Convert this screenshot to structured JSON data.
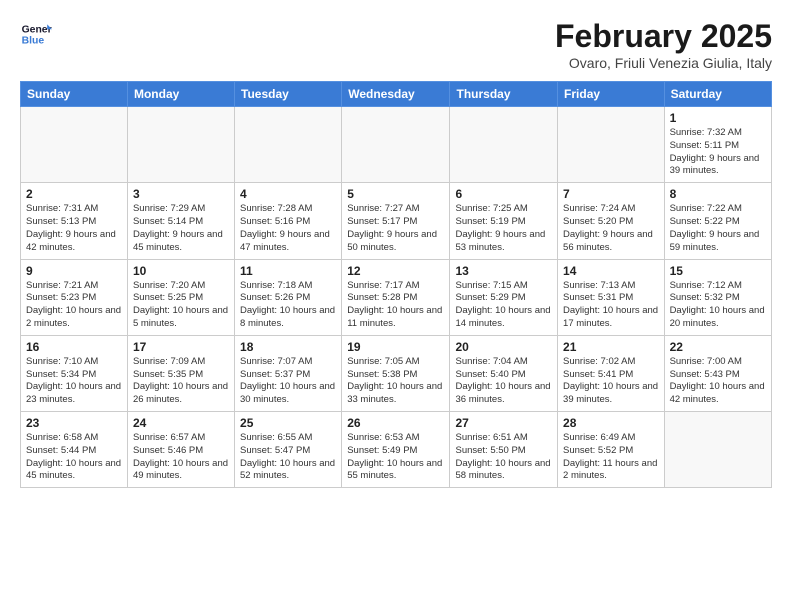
{
  "header": {
    "logo_line1": "General",
    "logo_line2": "Blue",
    "month": "February 2025",
    "location": "Ovaro, Friuli Venezia Giulia, Italy"
  },
  "days_of_week": [
    "Sunday",
    "Monday",
    "Tuesday",
    "Wednesday",
    "Thursday",
    "Friday",
    "Saturday"
  ],
  "weeks": [
    [
      {
        "num": "",
        "info": ""
      },
      {
        "num": "",
        "info": ""
      },
      {
        "num": "",
        "info": ""
      },
      {
        "num": "",
        "info": ""
      },
      {
        "num": "",
        "info": ""
      },
      {
        "num": "",
        "info": ""
      },
      {
        "num": "1",
        "info": "Sunrise: 7:32 AM\nSunset: 5:11 PM\nDaylight: 9 hours and 39 minutes."
      }
    ],
    [
      {
        "num": "2",
        "info": "Sunrise: 7:31 AM\nSunset: 5:13 PM\nDaylight: 9 hours and 42 minutes."
      },
      {
        "num": "3",
        "info": "Sunrise: 7:29 AM\nSunset: 5:14 PM\nDaylight: 9 hours and 45 minutes."
      },
      {
        "num": "4",
        "info": "Sunrise: 7:28 AM\nSunset: 5:16 PM\nDaylight: 9 hours and 47 minutes."
      },
      {
        "num": "5",
        "info": "Sunrise: 7:27 AM\nSunset: 5:17 PM\nDaylight: 9 hours and 50 minutes."
      },
      {
        "num": "6",
        "info": "Sunrise: 7:25 AM\nSunset: 5:19 PM\nDaylight: 9 hours and 53 minutes."
      },
      {
        "num": "7",
        "info": "Sunrise: 7:24 AM\nSunset: 5:20 PM\nDaylight: 9 hours and 56 minutes."
      },
      {
        "num": "8",
        "info": "Sunrise: 7:22 AM\nSunset: 5:22 PM\nDaylight: 9 hours and 59 minutes."
      }
    ],
    [
      {
        "num": "9",
        "info": "Sunrise: 7:21 AM\nSunset: 5:23 PM\nDaylight: 10 hours and 2 minutes."
      },
      {
        "num": "10",
        "info": "Sunrise: 7:20 AM\nSunset: 5:25 PM\nDaylight: 10 hours and 5 minutes."
      },
      {
        "num": "11",
        "info": "Sunrise: 7:18 AM\nSunset: 5:26 PM\nDaylight: 10 hours and 8 minutes."
      },
      {
        "num": "12",
        "info": "Sunrise: 7:17 AM\nSunset: 5:28 PM\nDaylight: 10 hours and 11 minutes."
      },
      {
        "num": "13",
        "info": "Sunrise: 7:15 AM\nSunset: 5:29 PM\nDaylight: 10 hours and 14 minutes."
      },
      {
        "num": "14",
        "info": "Sunrise: 7:13 AM\nSunset: 5:31 PM\nDaylight: 10 hours and 17 minutes."
      },
      {
        "num": "15",
        "info": "Sunrise: 7:12 AM\nSunset: 5:32 PM\nDaylight: 10 hours and 20 minutes."
      }
    ],
    [
      {
        "num": "16",
        "info": "Sunrise: 7:10 AM\nSunset: 5:34 PM\nDaylight: 10 hours and 23 minutes."
      },
      {
        "num": "17",
        "info": "Sunrise: 7:09 AM\nSunset: 5:35 PM\nDaylight: 10 hours and 26 minutes."
      },
      {
        "num": "18",
        "info": "Sunrise: 7:07 AM\nSunset: 5:37 PM\nDaylight: 10 hours and 30 minutes."
      },
      {
        "num": "19",
        "info": "Sunrise: 7:05 AM\nSunset: 5:38 PM\nDaylight: 10 hours and 33 minutes."
      },
      {
        "num": "20",
        "info": "Sunrise: 7:04 AM\nSunset: 5:40 PM\nDaylight: 10 hours and 36 minutes."
      },
      {
        "num": "21",
        "info": "Sunrise: 7:02 AM\nSunset: 5:41 PM\nDaylight: 10 hours and 39 minutes."
      },
      {
        "num": "22",
        "info": "Sunrise: 7:00 AM\nSunset: 5:43 PM\nDaylight: 10 hours and 42 minutes."
      }
    ],
    [
      {
        "num": "23",
        "info": "Sunrise: 6:58 AM\nSunset: 5:44 PM\nDaylight: 10 hours and 45 minutes."
      },
      {
        "num": "24",
        "info": "Sunrise: 6:57 AM\nSunset: 5:46 PM\nDaylight: 10 hours and 49 minutes."
      },
      {
        "num": "25",
        "info": "Sunrise: 6:55 AM\nSunset: 5:47 PM\nDaylight: 10 hours and 52 minutes."
      },
      {
        "num": "26",
        "info": "Sunrise: 6:53 AM\nSunset: 5:49 PM\nDaylight: 10 hours and 55 minutes."
      },
      {
        "num": "27",
        "info": "Sunrise: 6:51 AM\nSunset: 5:50 PM\nDaylight: 10 hours and 58 minutes."
      },
      {
        "num": "28",
        "info": "Sunrise: 6:49 AM\nSunset: 5:52 PM\nDaylight: 11 hours and 2 minutes."
      },
      {
        "num": "",
        "info": ""
      }
    ]
  ]
}
